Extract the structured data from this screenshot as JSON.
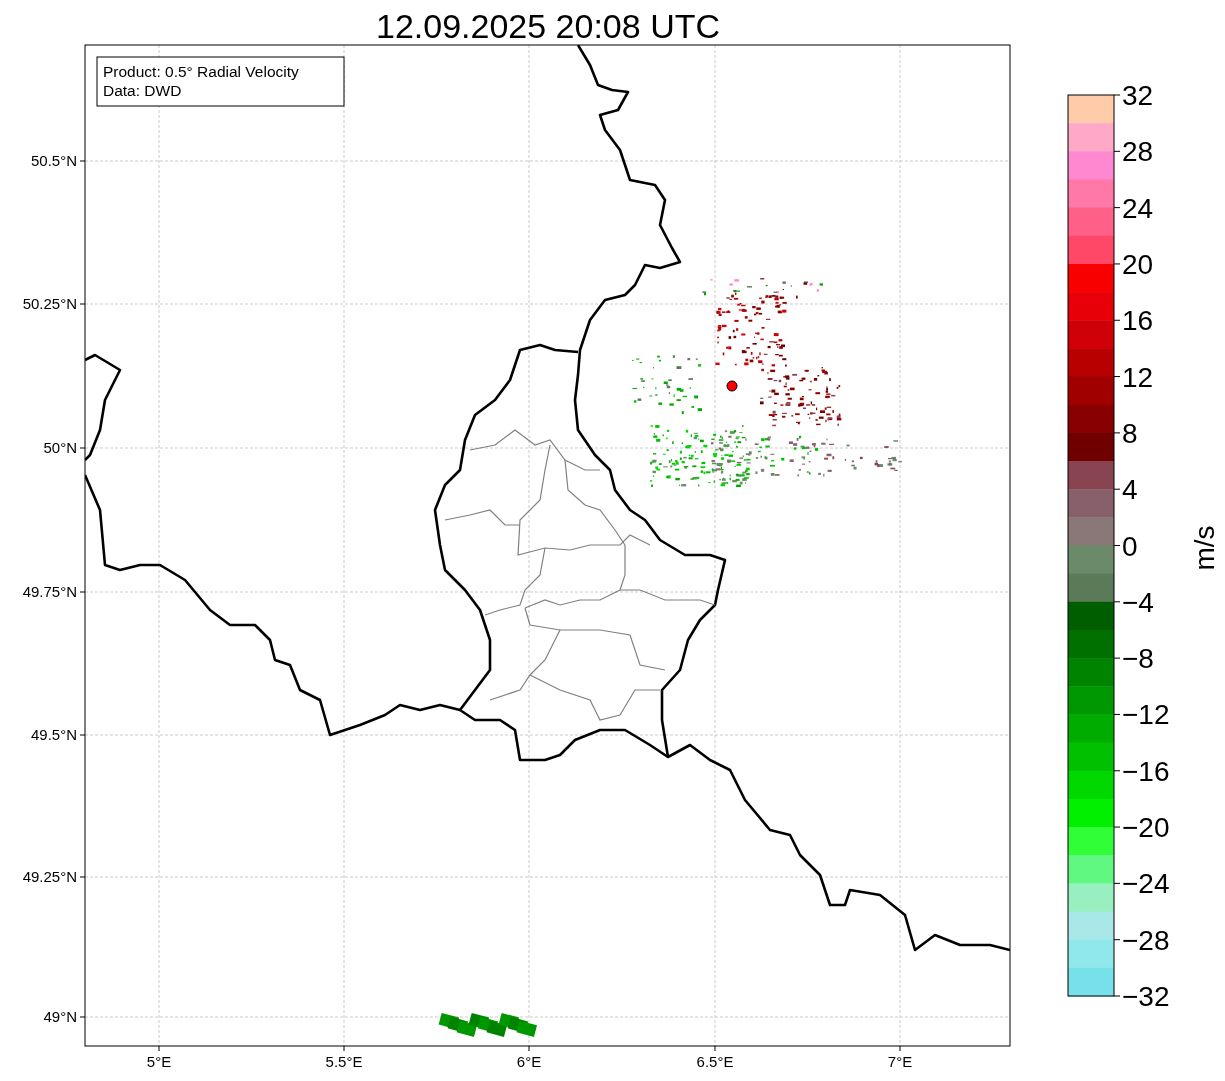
{
  "title": "12.09.2025 20:08 UTC",
  "annotation": [
    "Product: 0.5° Radial Velocity",
    "Data: DWD"
  ],
  "x_ticks": [
    "5°E",
    "5.5°E",
    "6°E",
    "6.5°E",
    "7°E"
  ],
  "y_ticks": [
    "50.5°N",
    "50.25°N",
    "50°N",
    "49.75°N",
    "49.5°N",
    "49.25°N",
    "49°N"
  ],
  "colorbar": {
    "label": "m/s",
    "ticks": [
      "32",
      "28",
      "24",
      "20",
      "16",
      "12",
      "8",
      "4",
      "0",
      "−4",
      "−8",
      "−12",
      "−16",
      "−20",
      "−24",
      "−28",
      "−32"
    ]
  }
}
